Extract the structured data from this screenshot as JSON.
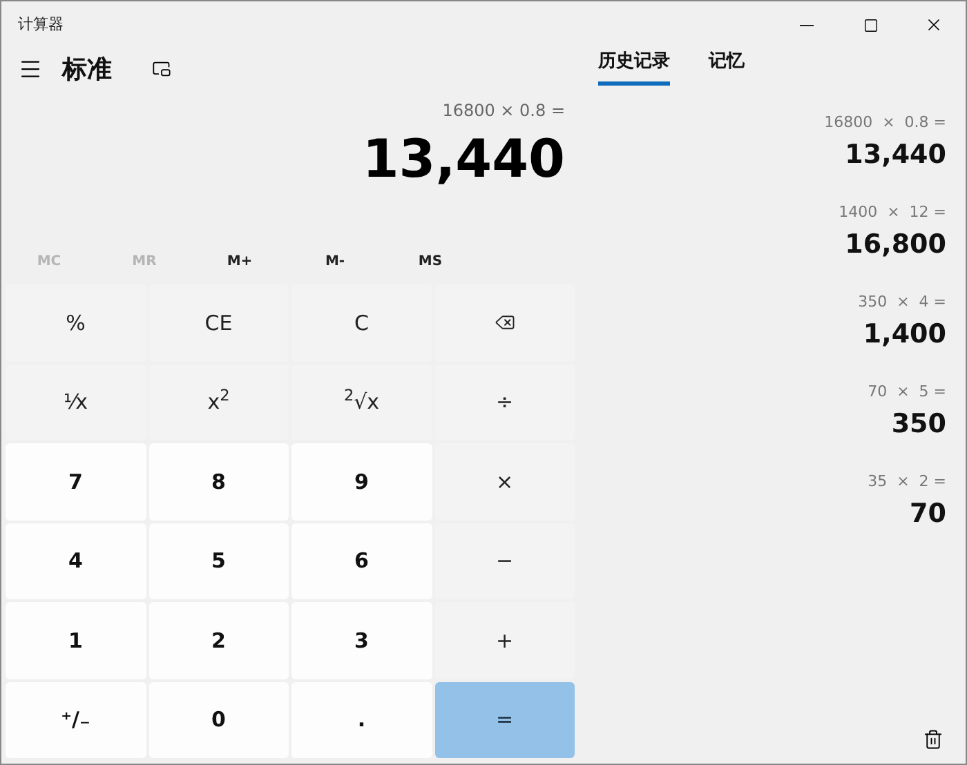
{
  "window": {
    "title": "计算器"
  },
  "header": {
    "mode": "标准"
  },
  "display": {
    "expression": "16800 × 0.8 =",
    "value": "13,440"
  },
  "memory_buttons": [
    {
      "label": "MC",
      "disabled": true
    },
    {
      "label": "MR",
      "disabled": true
    },
    {
      "label": "M+",
      "disabled": false
    },
    {
      "label": "M-",
      "disabled": false
    },
    {
      "label": "MS",
      "disabled": false
    }
  ],
  "keys": [
    {
      "kind": "function",
      "label": "%"
    },
    {
      "kind": "function",
      "label": "CE"
    },
    {
      "kind": "function",
      "label": "C"
    },
    {
      "kind": "backspace"
    },
    {
      "kind": "function",
      "label": "⅟x"
    },
    {
      "kind": "function",
      "label": "x$^{2}$"
    },
    {
      "kind": "function",
      "label": "$^{2}$√x"
    },
    {
      "kind": "operator",
      "label": "÷"
    },
    {
      "kind": "digit",
      "label": "7"
    },
    {
      "kind": "digit",
      "label": "8"
    },
    {
      "kind": "digit",
      "label": "9"
    },
    {
      "kind": "operator",
      "label": "×"
    },
    {
      "kind": "digit",
      "label": "4"
    },
    {
      "kind": "digit",
      "label": "5"
    },
    {
      "kind": "digit",
      "label": "6"
    },
    {
      "kind": "operator",
      "label": "−"
    },
    {
      "kind": "digit",
      "label": "1"
    },
    {
      "kind": "digit",
      "label": "2"
    },
    {
      "kind": "digit",
      "label": "3"
    },
    {
      "kind": "operator",
      "label": "+"
    },
    {
      "kind": "digit",
      "label": "⁺/₋"
    },
    {
      "kind": "digit",
      "label": "0"
    },
    {
      "kind": "digit",
      "label": "."
    },
    {
      "kind": "equals",
      "label": "="
    }
  ],
  "tabs": [
    {
      "label": "历史记录",
      "selected": true
    },
    {
      "label": "记忆",
      "selected": false
    }
  ],
  "history": [
    {
      "a": "16800",
      "op": "×",
      "b": "0.8",
      "eq": "=",
      "result": "13,440"
    },
    {
      "a": "1400",
      "op": "×",
      "b": "12",
      "eq": "=",
      "result": "16,800"
    },
    {
      "a": "350",
      "op": "×",
      "b": "4",
      "eq": "=",
      "result": "1,400"
    },
    {
      "a": "70",
      "op": "×",
      "b": "5",
      "eq": "=",
      "result": "350"
    },
    {
      "a": "35",
      "op": "×",
      "b": "2",
      "eq": "=",
      "result": "70"
    }
  ]
}
